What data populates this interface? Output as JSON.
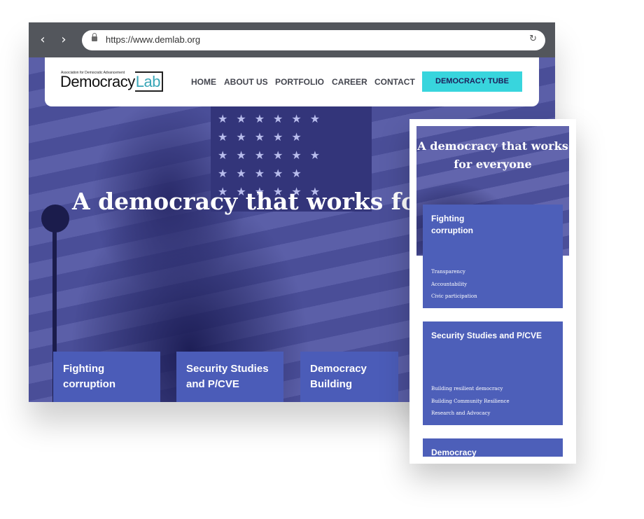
{
  "browser": {
    "back_icon": "chevron-left-icon",
    "forward_icon": "chevron-right-icon",
    "url": "https://www.demlab.org",
    "reload_icon": "reload-icon"
  },
  "site": {
    "logo_small": "Association for Democratic Advancement",
    "logo_main": "Democracy",
    "logo_accent": "Lab",
    "nav": [
      "HOME",
      "ABOUT US",
      "PORTFOLIO",
      "CAREER",
      "CONTACT"
    ],
    "cta": "DEMOCRACY TUBE",
    "headline": "A democracy that works for e",
    "cards": [
      "Fighting corruption",
      "Security Studies and P/CVE",
      "Democracy Building"
    ]
  },
  "mobile": {
    "headline_line1": "A democracy that works",
    "headline_line2": "for everyone",
    "cards": [
      {
        "title": "Fighting corruption",
        "links": [
          "Transparency",
          "Accountability",
          "Civic participation"
        ]
      },
      {
        "title": "Security Studies and P/CVE",
        "links": [
          "Building resilient democracy",
          "Building Community Resilience",
          "Research and Advocacy"
        ]
      },
      {
        "title": "Democracy",
        "links": []
      }
    ]
  },
  "colors": {
    "accent": "#38d5dd",
    "card": "#4b5cb8",
    "hero": "#3d3f7f"
  }
}
